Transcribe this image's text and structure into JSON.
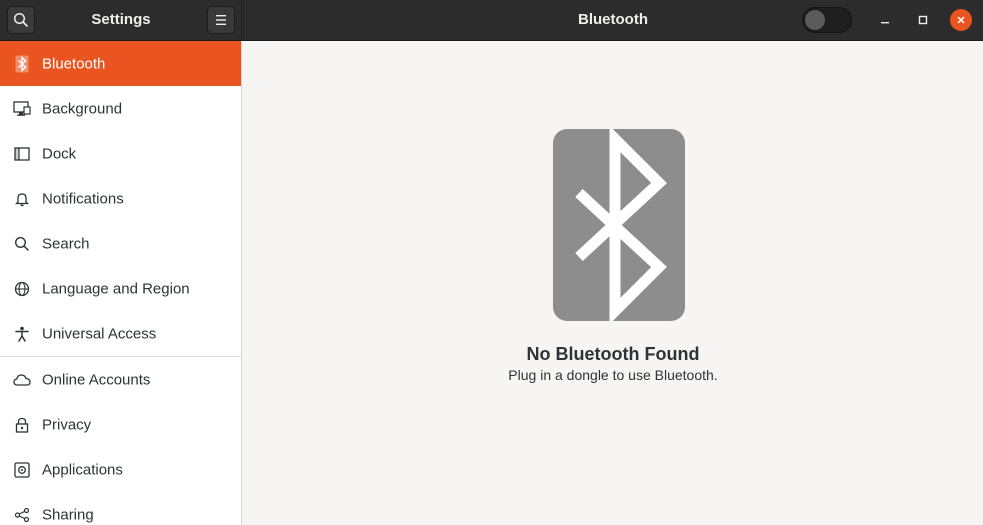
{
  "header": {
    "settings_title": "Settings",
    "panel_title": "Bluetooth",
    "bluetooth_switch_on": false
  },
  "sidebar": {
    "items": [
      {
        "label": "Bluetooth",
        "icon": "bluetooth-icon",
        "active": true
      },
      {
        "label": "Background",
        "icon": "background-icon"
      },
      {
        "label": "Dock",
        "icon": "dock-icon"
      },
      {
        "label": "Notifications",
        "icon": "bell-icon"
      },
      {
        "label": "Search",
        "icon": "search-icon"
      },
      {
        "label": "Language and Region",
        "icon": "globe-icon"
      },
      {
        "label": "Universal Access",
        "icon": "accessibility-icon"
      },
      {
        "label": "Online Accounts",
        "icon": "cloud-icon"
      },
      {
        "label": "Privacy",
        "icon": "lock-icon"
      },
      {
        "label": "Applications",
        "icon": "applications-icon"
      },
      {
        "label": "Sharing",
        "icon": "share-icon"
      }
    ]
  },
  "main": {
    "empty_title": "No Bluetooth Found",
    "empty_subtitle": "Plug in a dongle to use Bluetooth.",
    "icon": "bluetooth-icon"
  },
  "colors": {
    "accent": "#e95420",
    "headerbar": "#2c2c2c",
    "tile": "#8d8d8d",
    "background": "#f6f5f4"
  }
}
